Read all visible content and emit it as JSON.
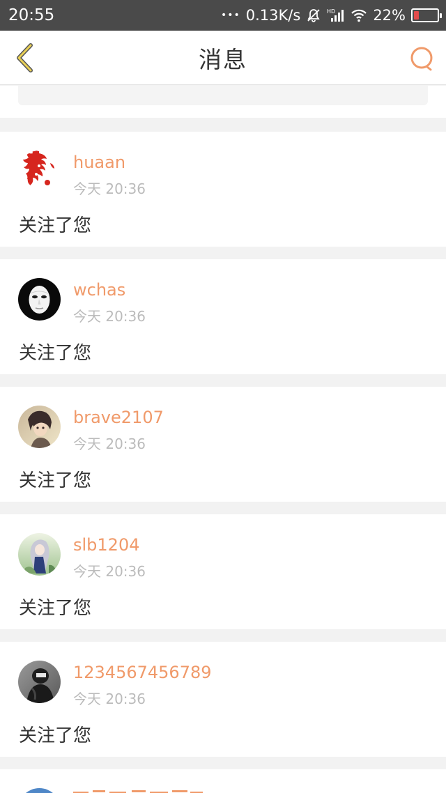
{
  "status_bar": {
    "time": "20:55",
    "dots": "•••",
    "speed": "0.13K/s",
    "battery": "22%",
    "battery_level": 0.22,
    "icons": [
      "mute-bell-icon",
      "hd-signal-icon",
      "wifi-icon",
      "battery-icon"
    ]
  },
  "nav": {
    "title": "消息",
    "back_icon": "chevron-left-icon",
    "search_icon": "search-icon"
  },
  "messages": [
    {
      "username": "huaan",
      "time": "今天 20:36",
      "text": "关注了您",
      "avatar": "red-dragon-papercut"
    },
    {
      "username": "wchas",
      "time": "今天 20:36",
      "text": "关注了您",
      "avatar": "white-mask"
    },
    {
      "username": "brave2107",
      "time": "今天 20:36",
      "text": "关注了您",
      "avatar": "anime-boy"
    },
    {
      "username": "slb1204",
      "time": "今天 20:36",
      "text": "关注了您",
      "avatar": "anime-girl"
    },
    {
      "username": "1234567456789",
      "time": "今天 20:36",
      "text": "关注了您",
      "avatar": "dark-figure"
    }
  ],
  "colors": {
    "accent": "#f09a6a",
    "status_bar": "#4a4a4a",
    "back_icon": "#e5c74a"
  }
}
